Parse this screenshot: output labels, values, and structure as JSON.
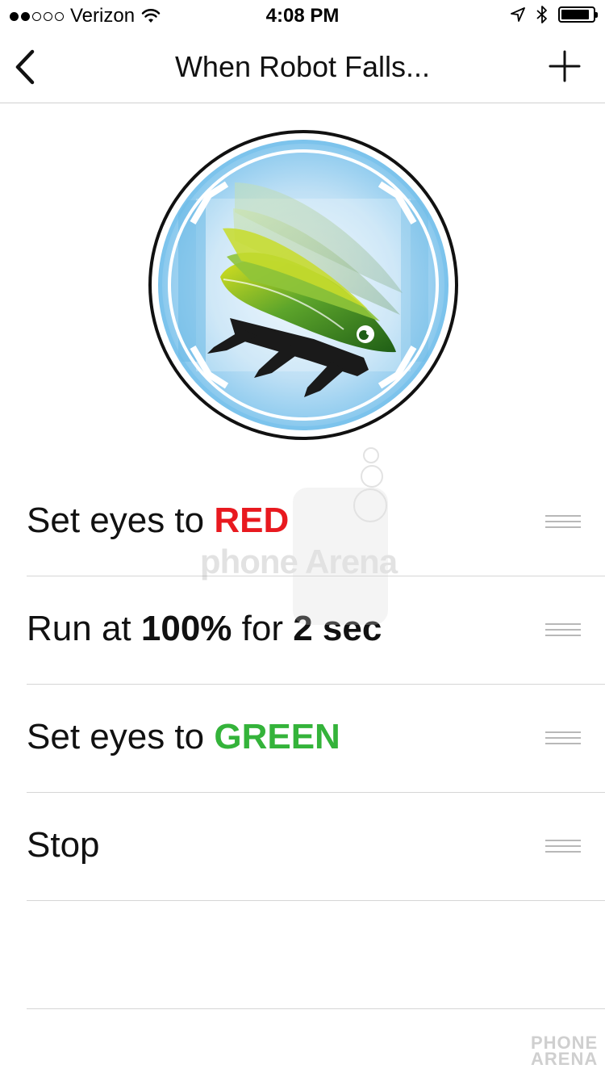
{
  "status_bar": {
    "carrier": "Verizon",
    "signal_bars_filled": 2,
    "signal_bars_total": 5,
    "time": "4:08 PM",
    "icons": [
      "wifi-icon",
      "location-arrow-icon",
      "bluetooth-icon",
      "battery-icon"
    ],
    "battery_level": 0.9
  },
  "nav": {
    "title": "When Robot Falls...",
    "back_icon": "chevron-left-icon",
    "add_icon": "plus-icon"
  },
  "actions": [
    {
      "prefix": "Set eyes to ",
      "value": "RED",
      "value_color": "#e8191f"
    },
    {
      "prefix": "Run at ",
      "value1": "100%",
      "middle": " for ",
      "value2": "2 sec"
    },
    {
      "prefix": "Set eyes to ",
      "value": "GREEN",
      "value_color": "#34b33a"
    },
    {
      "prefix": "Stop"
    }
  ],
  "watermark": {
    "center": "phone Arena",
    "corner_line1": "PHONE",
    "corner_line2": "ARENA"
  },
  "colors": {
    "red": "#e8191f",
    "green": "#34b33a",
    "badge_blue": "#7cc3ec",
    "robot_green": "#2f7d1f"
  }
}
